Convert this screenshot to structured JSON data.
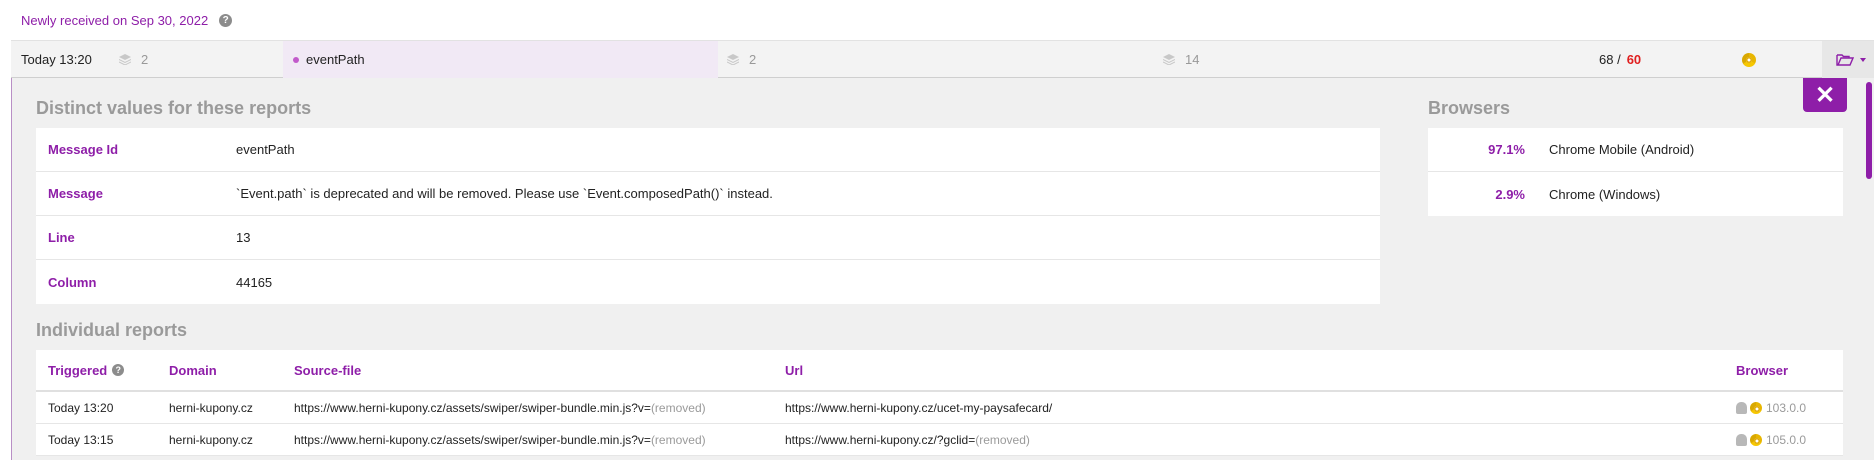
{
  "header": {
    "title": "Newly received on Sep 30, 2022"
  },
  "summary": {
    "time": "Today 13:20",
    "count_a": "2",
    "message_id": "eventPath",
    "count_b": "2",
    "count_c": "14",
    "ratio_total": "68 /",
    "ratio_hot": "60"
  },
  "distinct": {
    "title": "Distinct values for these reports",
    "rows": [
      {
        "key": "Message Id",
        "value": "eventPath"
      },
      {
        "key": "Message",
        "value": "`Event.path` is deprecated and will be removed. Please use `Event.composedPath()` instead."
      },
      {
        "key": "Line",
        "value": "13"
      },
      {
        "key": "Column",
        "value": "44165"
      }
    ]
  },
  "browsers": {
    "title": "Browsers",
    "rows": [
      {
        "pct": "97.1%",
        "name": "Chrome Mobile (Android)"
      },
      {
        "pct": "2.9%",
        "name": "Chrome (Windows)"
      }
    ]
  },
  "reports": {
    "title": "Individual reports",
    "columns": {
      "triggered": "Triggered",
      "domain": "Domain",
      "source": "Source-file",
      "url": "Url",
      "browser": "Browser"
    },
    "rows": [
      {
        "triggered": "Today 13:20",
        "domain": "herni-kupony.cz",
        "source": "https://www.herni-kupony.cz/assets/swiper/swiper-bundle.min.js?v=",
        "source_removed": "(removed)",
        "url": "https://www.herni-kupony.cz/ucet-my-paysafecard/",
        "url_removed": "",
        "version": "103.0.0"
      },
      {
        "triggered": "Today 13:15",
        "domain": "herni-kupony.cz",
        "source": "https://www.herni-kupony.cz/assets/swiper/swiper-bundle.min.js?v=",
        "source_removed": "(removed)",
        "url": "https://www.herni-kupony.cz/?gclid=",
        "url_removed": "(removed)",
        "version": "105.0.0"
      }
    ]
  },
  "icons": {
    "help": "question-circle-icon",
    "layers": "layers-icon",
    "browser": "chrome-icon",
    "os": "android-icon",
    "folder": "folder-open-icon",
    "close": "close-icon"
  },
  "colors": {
    "accent": "#8e1ea8",
    "hot": "#e02020",
    "panel": "#f0f0f0"
  }
}
